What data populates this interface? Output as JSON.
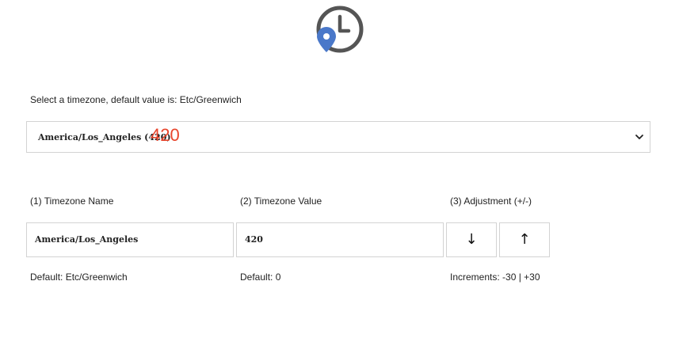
{
  "logo": {
    "icon": "clock-location-icon"
  },
  "selector": {
    "label": "Select a timezone, default value is: Etc/Greenwich",
    "selected_text": "America/Los_Angeles (420)",
    "overlay_value": "420"
  },
  "columns": {
    "name_label": "(1) Timezone Name",
    "value_label": "(2) Timezone Value",
    "adjustment_label": "(3) Adjustment (+/-)"
  },
  "fields": {
    "timezone_name": "America/Los_Angeles",
    "timezone_value": "420"
  },
  "buttons": {
    "decrement": "↓",
    "increment": "↑"
  },
  "hints": {
    "name_default": "Default: Etc/Greenwich",
    "value_default": "Default: 0",
    "increments": "Increments: -30 | +30"
  },
  "colors": {
    "accent_blue": "#4a78c9",
    "clock_gray": "#555555",
    "overlay_red": "#e8452c"
  }
}
